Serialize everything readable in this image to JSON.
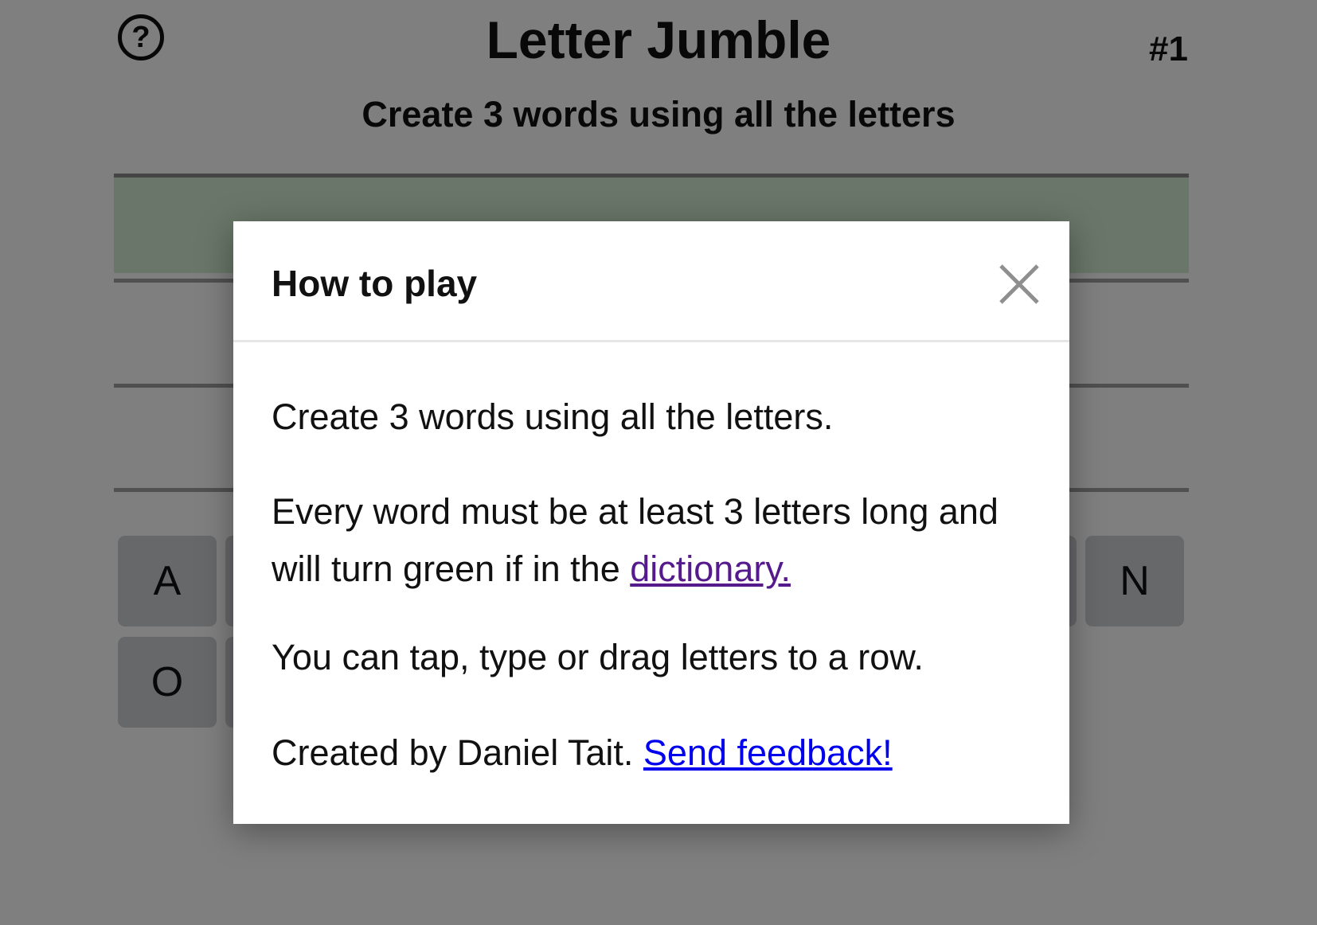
{
  "header": {
    "help_icon_glyph": "?",
    "title": "Letter Jumble",
    "puzzle_number": "#1",
    "subtitle": "Create 3 words using all the letters"
  },
  "board": {
    "rows": [
      {
        "state": "valid",
        "letters": ""
      },
      {
        "state": "empty",
        "letters": ""
      },
      {
        "state": "empty",
        "letters": ""
      }
    ],
    "valid_row_color": "#d2edd2",
    "tile_color": "#cfd0d4",
    "tiles_visible": [
      "A",
      "N",
      "O"
    ]
  },
  "modal": {
    "title": "How to play",
    "close_icon": "close-icon",
    "paragraphs": {
      "rule1": "Create 3 words using all the letters.",
      "rule2_text": "Every word must be at least 3 letters long and will turn green if in the ",
      "rule2_link": "dictionary.",
      "rule3": "You can tap, type or drag letters to a row.",
      "credit_text": "Created by Daniel Tait. ",
      "credit_link": "Send feedback!"
    }
  },
  "colors": {
    "overlay": "rgba(0,0,0,0.5)",
    "link": "#0000ee",
    "visited_link": "#551a8b"
  }
}
